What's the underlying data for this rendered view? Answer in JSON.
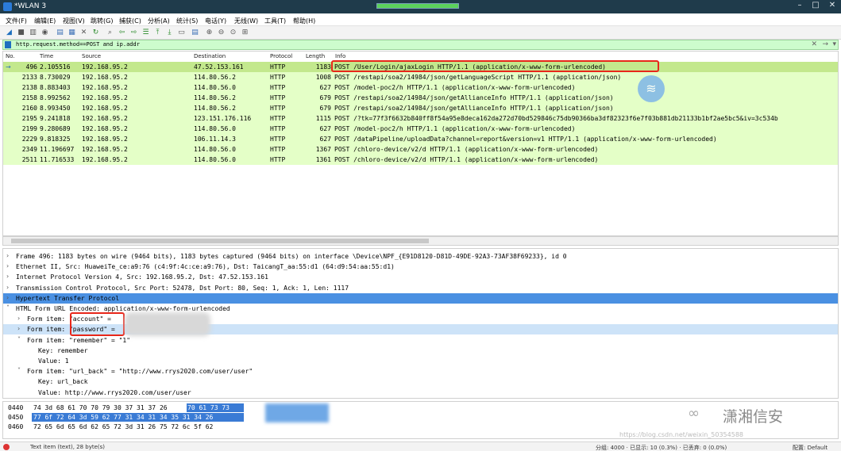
{
  "window": {
    "title": "*WLAN 3",
    "minimize": "–",
    "maximize": "□",
    "close": "✕",
    "capture_progress": 1.0
  },
  "menu": [
    "文件(F)",
    "编辑(E)",
    "视图(V)",
    "跳转(G)",
    "捕获(C)",
    "分析(A)",
    "统计(S)",
    "电话(Y)",
    "无线(W)",
    "工具(T)",
    "帮助(H)"
  ],
  "filter": {
    "value": "http.request.method==POST and ip.addr",
    "clear": "✕",
    "apply": "→",
    "dropdown": "▾"
  },
  "packet_columns": [
    "No.",
    "Time",
    "Source",
    "Destination",
    "Protocol",
    "Length",
    "Info"
  ],
  "packets": [
    {
      "no": "496",
      "time": "2.105516",
      "src": "192.168.95.2",
      "dst": "47.52.153.161",
      "proto": "HTTP",
      "len": "1183",
      "info": "POST /User/Login/ajaxLogin HTTP/1.1  (application/x-www-form-urlencoded)",
      "selected": true,
      "marker": "→"
    },
    {
      "no": "2133",
      "time": "8.730029",
      "src": "192.168.95.2",
      "dst": "114.80.56.2",
      "proto": "HTTP",
      "len": "1008",
      "info": "POST /restapi/soa2/14984/json/getLanguageScript HTTP/1.1  (application/json)"
    },
    {
      "no": "2138",
      "time": "8.883403",
      "src": "192.168.95.2",
      "dst": "114.80.56.0",
      "proto": "HTTP",
      "len": "627",
      "info": "POST /model-poc2/h HTTP/1.1  (application/x-www-form-urlencoded)"
    },
    {
      "no": "2158",
      "time": "8.992562",
      "src": "192.168.95.2",
      "dst": "114.80.56.2",
      "proto": "HTTP",
      "len": "679",
      "info": "POST /restapi/soa2/14984/json/getAllianceInfo HTTP/1.1  (application/json)"
    },
    {
      "no": "2160",
      "time": "8.993450",
      "src": "192.168.95.2",
      "dst": "114.80.56.2",
      "proto": "HTTP",
      "len": "679",
      "info": "POST /restapi/soa2/14984/json/getAllianceInfo HTTP/1.1  (application/json)"
    },
    {
      "no": "2195",
      "time": "9.241818",
      "src": "192.168.95.2",
      "dst": "123.151.176.116",
      "proto": "HTTP",
      "len": "1115",
      "info": "POST /?tk=77f3f6632b840ff8f54a95e8deca162da272d70bd529846c75db90366ba3df82323f6e7f03b881db21133b1bf2ae5bc5&iv=3c534b"
    },
    {
      "no": "2199",
      "time": "9.280689",
      "src": "192.168.95.2",
      "dst": "114.80.56.0",
      "proto": "HTTP",
      "len": "627",
      "info": "POST /model-poc2/h HTTP/1.1  (application/x-www-form-urlencoded)"
    },
    {
      "no": "2229",
      "time": "9.818325",
      "src": "192.168.95.2",
      "dst": "106.11.14.3",
      "proto": "HTTP",
      "len": "627",
      "info": "POST /dataPipeline/uploadData?channel=report&version=v1 HTTP/1.1  (application/x-www-form-urlencoded)"
    },
    {
      "no": "2349",
      "time": "11.196697",
      "src": "192.168.95.2",
      "dst": "114.80.56.0",
      "proto": "HTTP",
      "len": "1367",
      "info": "POST /chloro-device/v2/d HTTP/1.1  (application/x-www-form-urlencoded)"
    },
    {
      "no": "2511",
      "time": "11.716533",
      "src": "192.168.95.2",
      "dst": "114.80.56.0",
      "proto": "HTTP",
      "len": "1361",
      "info": "POST /chloro-device/v2/d HTTP/1.1  (application/x-www-form-urlencoded)"
    }
  ],
  "details": [
    {
      "arrow": "›",
      "text": "Frame 496: 1183 bytes on wire (9464 bits), 1183 bytes captured (9464 bits) on interface \\Device\\NPF_{E91D8120-D81D-49DE-92A3-73AF38F69233}, id 0"
    },
    {
      "arrow": "›",
      "text": "Ethernet II, Src: HuaweiTe_ce:a9:76 (c4:9f:4c:ce:a9:76), Dst: TaicangT_aa:55:d1 (64:d9:54:aa:55:d1)"
    },
    {
      "arrow": "›",
      "text": "Internet Protocol Version 4, Src: 192.168.95.2, Dst: 47.52.153.161"
    },
    {
      "arrow": "›",
      "text": "Transmission Control Protocol, Src Port: 52478, Dst Port: 80, Seq: 1, Ack: 1, Len: 1117"
    },
    {
      "arrow": "›",
      "text": "Hypertext Transfer Protocol",
      "style": "sel"
    },
    {
      "arrow": "˅",
      "text": "HTML Form URL Encoded: application/x-www-form-urlencoded"
    },
    {
      "arrow": "›",
      "text": "Form item: \"account\" = ",
      "style": "indent1"
    },
    {
      "arrow": "›",
      "text": "Form item: \"password\" = ",
      "style": "indent1sub"
    },
    {
      "arrow": "˅",
      "text": "Form item: \"remember\" = \"1\"",
      "style": "indent1"
    },
    {
      "arrow": "",
      "text": "Key: remember",
      "style": "indent2"
    },
    {
      "arrow": "",
      "text": "Value: 1",
      "style": "indent2"
    },
    {
      "arrow": "˅",
      "text": "Form item: \"url_back\" = \"http://www.rrys2020.com/user/user\"",
      "style": "indent1"
    },
    {
      "arrow": "",
      "text": "Key: url_back",
      "style": "indent2"
    },
    {
      "arrow": "",
      "text": "Value: http://www.rrys2020.com/user/user",
      "style": "indent2"
    }
  ],
  "bytes": [
    {
      "offset": "0440",
      "hex_plain": "74 3d 68 61 70 70 79 30  37 31 37 26 ",
      "hex_sel": "70 61 73 73"
    },
    {
      "offset": "0450",
      "hex_plain": "",
      "hex_sel": "77 6f 72 64 3d 59 62 77  31 34 31 34 35 31 34 26"
    },
    {
      "offset": "0460",
      "hex_plain": "72 65 6d 65 6d 62 65 72  3d 31 26 75 72 6c 5f 62",
      "hex_sel": ""
    }
  ],
  "watermark": {
    "name": "潇湘信安"
  },
  "csdn_mark": "https://blog.csdn.net/weixin_50354588",
  "status": {
    "field": "Text item (text), 28 byte(s)",
    "counts": "分组: 4000 · 已显示: 10 (0.3%) · 已丢弃: 0 (0.0%)",
    "profile": "配置: Default"
  }
}
